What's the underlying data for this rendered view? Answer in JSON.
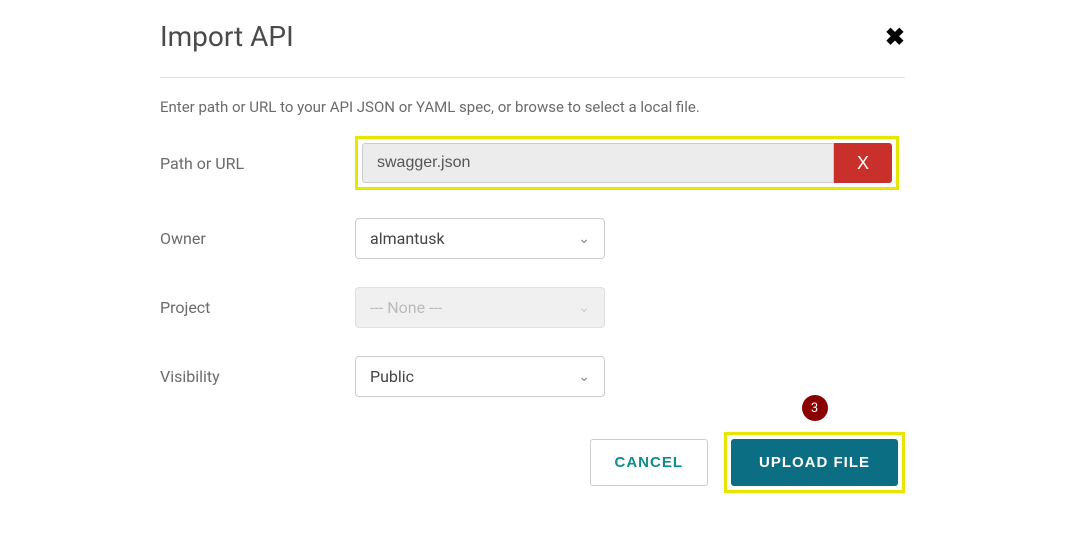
{
  "modal": {
    "title": "Import API",
    "instruction": "Enter path or URL to your API JSON or YAML spec, or browse to select a local file."
  },
  "fields": {
    "path": {
      "label": "Path or URL",
      "value": "swagger.json",
      "clear_label": "X"
    },
    "owner": {
      "label": "Owner",
      "value": "almantusk"
    },
    "project": {
      "label": "Project",
      "value": "--- None ---"
    },
    "visibility": {
      "label": "Visibility",
      "value": "Public"
    }
  },
  "actions": {
    "cancel": "CANCEL",
    "upload": "UPLOAD FILE"
  },
  "annotation": {
    "badge": "3"
  }
}
